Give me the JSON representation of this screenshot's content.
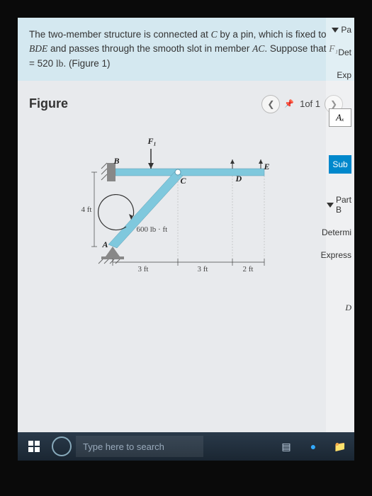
{
  "problem": {
    "text_parts": [
      "The two-member structure is connected at ",
      " by a pin, which is fixed to ",
      " and passes through the smooth slot in member ",
      ". Suppose that ",
      " = 520 ",
      ". (Figure 1)"
    ],
    "var_C": "C",
    "var_BDE": "BDE",
    "var_AC": "AC",
    "var_F1": "F₁",
    "unit_lb": "lb"
  },
  "figure": {
    "title": "Figure",
    "nav_current": "1",
    "nav_total": "of 1",
    "labels": {
      "F1": "F₁",
      "B": "B",
      "C": "C",
      "D": "D",
      "E": "E",
      "A": "A",
      "load": "600 lb · ft",
      "h": "4 ft",
      "d1": "3 ft",
      "d2": "3 ft",
      "d3": "2 ft"
    }
  },
  "right_panel": {
    "pa": "Pa",
    "det": "Det",
    "exp": "Exp",
    "az": "Aₓ",
    "sub": "Sub",
    "partB": "Part B",
    "determi": "Determi",
    "express": "Express",
    "d": "D"
  },
  "taskbar": {
    "search_placeholder": "Type here to search"
  }
}
